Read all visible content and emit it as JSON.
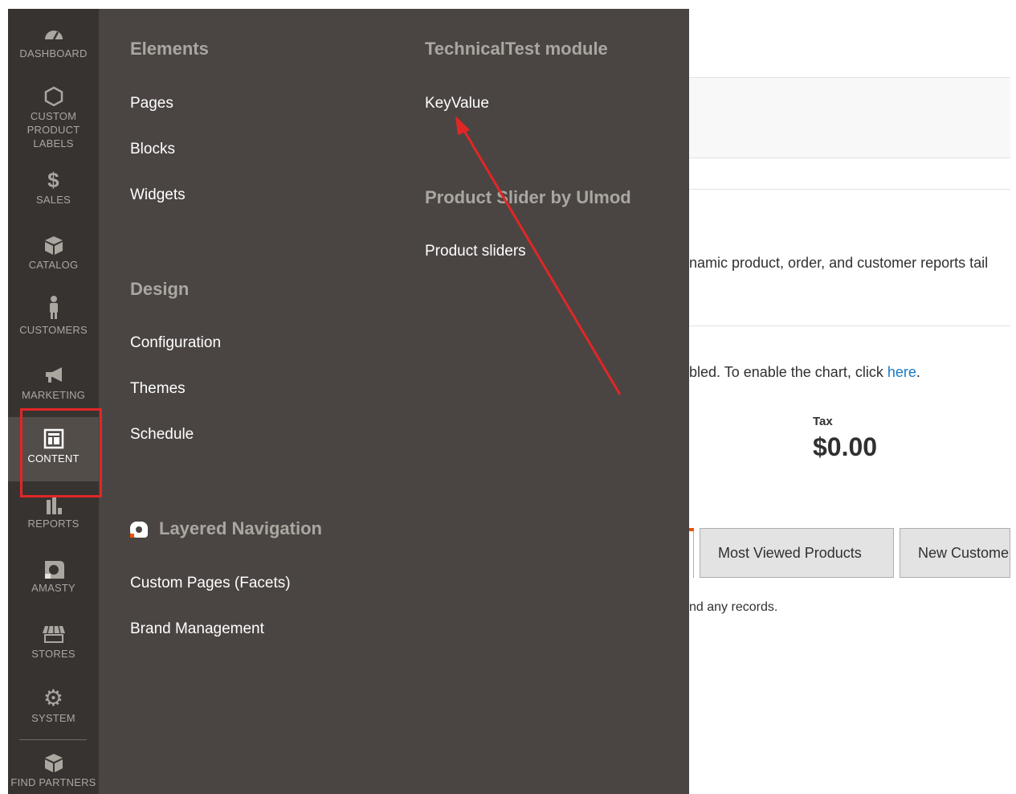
{
  "sidebar": {
    "items": [
      {
        "label": "DASHBOARD",
        "icon": "dashboard-gauge-icon"
      },
      {
        "label": "CUSTOM PRODUCT LABELS",
        "icon": "hexagon-icon"
      },
      {
        "label": "SALES",
        "icon": "dollar-icon"
      },
      {
        "label": "CATALOG",
        "icon": "box-icon"
      },
      {
        "label": "CUSTOMERS",
        "icon": "person-icon"
      },
      {
        "label": "MARKETING",
        "icon": "megaphone-icon"
      },
      {
        "label": "CONTENT",
        "icon": "layout-icon",
        "active": true
      },
      {
        "label": "REPORTS",
        "icon": "bar-chart-icon"
      },
      {
        "label": "AMASTY",
        "icon": "amasty-icon"
      },
      {
        "label": "STORES",
        "icon": "storefront-icon"
      },
      {
        "label": "SYSTEM",
        "icon": "gear-icon"
      },
      {
        "label": "FIND PARTNERS",
        "icon": "partners-box-icon"
      }
    ]
  },
  "flyout": {
    "elements": {
      "title": "Elements",
      "links": [
        "Pages",
        "Blocks",
        "Widgets"
      ]
    },
    "design": {
      "title": "Design",
      "links": [
        "Configuration",
        "Themes",
        "Schedule"
      ]
    },
    "layered": {
      "title": "Layered Navigation",
      "links": [
        "Custom Pages (Facets)",
        "Brand Management"
      ]
    },
    "technical": {
      "title": "TechnicalTest module",
      "links": [
        "KeyValue"
      ]
    },
    "slider": {
      "title": "Product Slider by Ulmod",
      "links": [
        "Product sliders"
      ]
    }
  },
  "background": {
    "reports_text": "namic product, order, and customer reports tail",
    "chart_text_before": "bled. To enable the chart, click ",
    "chart_link": "here",
    "chart_text_after": ".",
    "tax_label": "Tax",
    "tax_value": "$0.00",
    "tabs": [
      "Most Viewed Products",
      "New Custome"
    ],
    "records_text": "nd any records."
  },
  "colors": {
    "sidebar_bg": "#373330",
    "flyout_bg": "#4a4542",
    "annotation_red": "#e22626",
    "link_blue": "#1979c3"
  }
}
